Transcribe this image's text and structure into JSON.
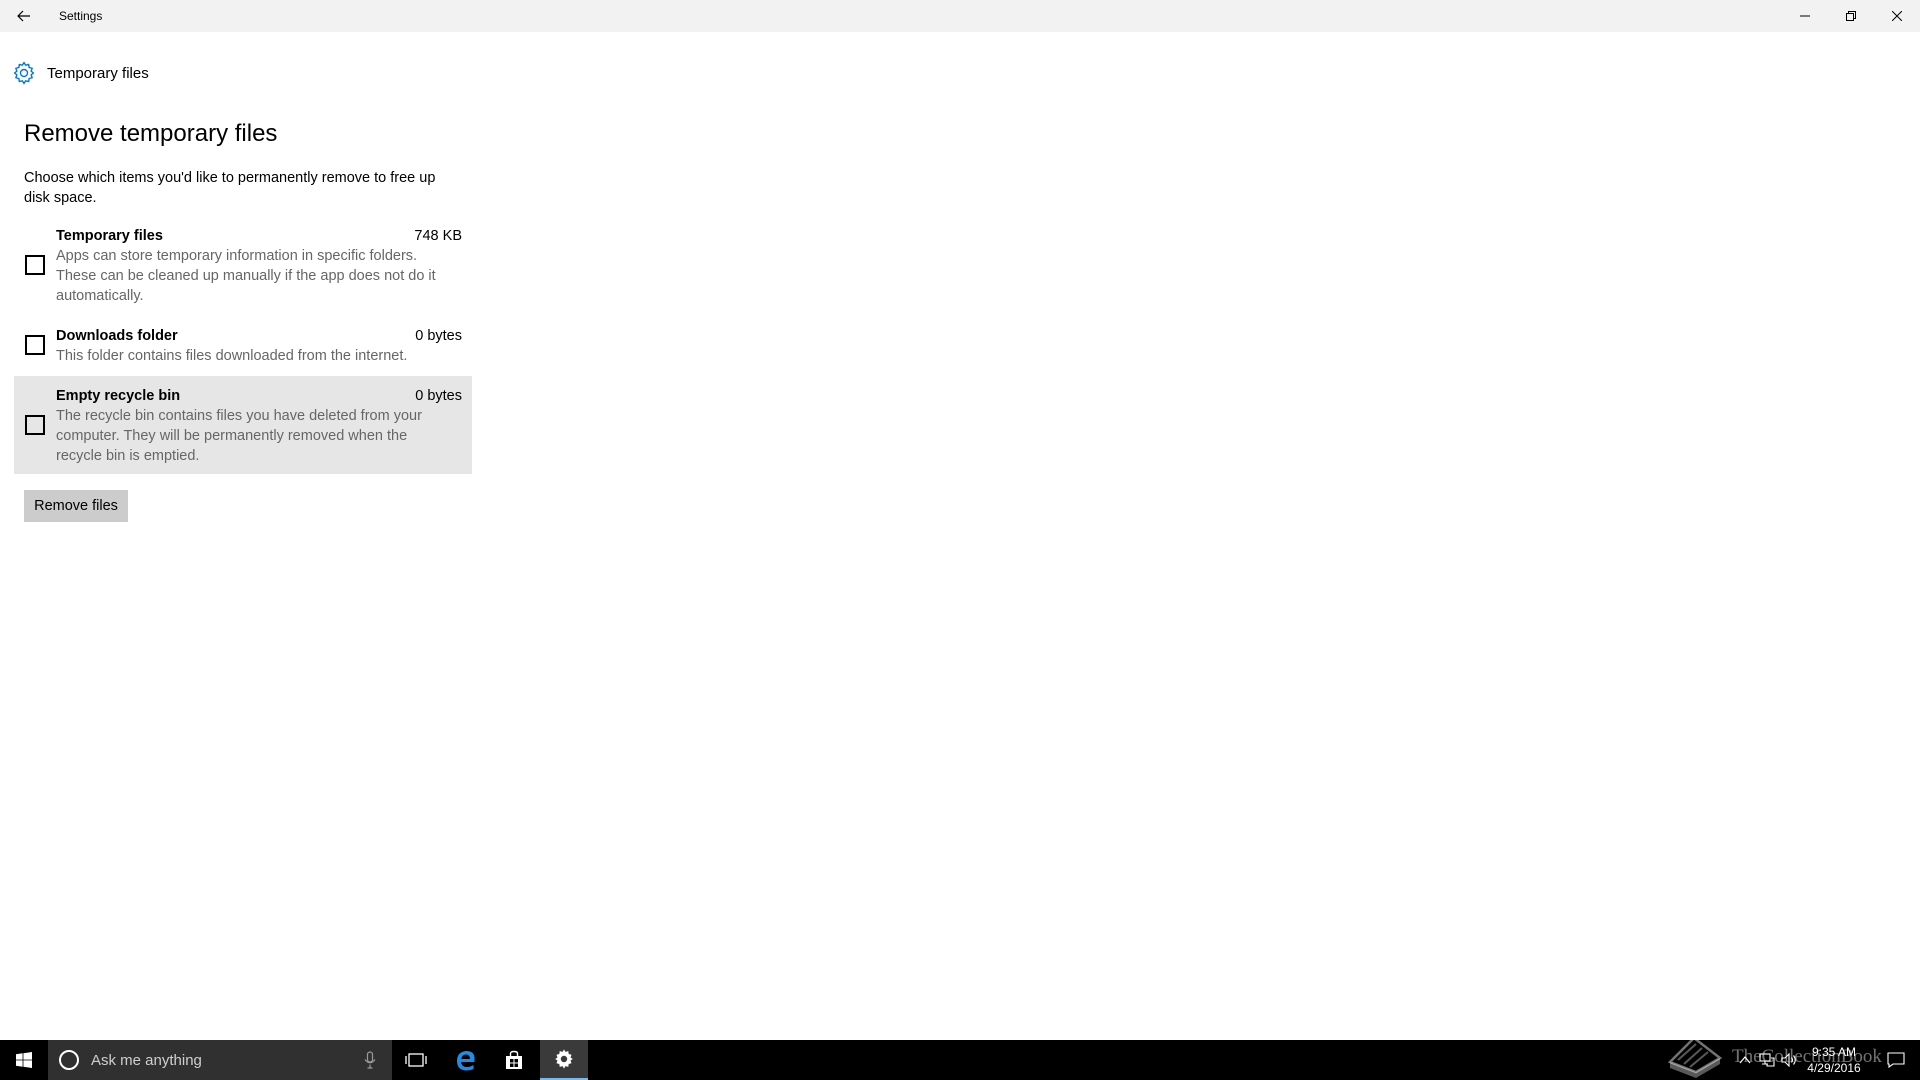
{
  "window": {
    "title": "Settings"
  },
  "header": {
    "title": "Temporary files"
  },
  "section": {
    "title": "Remove temporary files",
    "intro": "Choose which items you'd like to permanently remove to free up disk space."
  },
  "items": [
    {
      "name": "Temporary files",
      "size": "748 KB",
      "description": "Apps can store temporary information in specific folders. These can be cleaned up manually if the app does not do it automatically.",
      "checked": false
    },
    {
      "name": "Downloads folder",
      "size": "0 bytes",
      "description": "This folder contains files downloaded from the internet.",
      "checked": false
    },
    {
      "name": "Empty recycle bin",
      "size": "0 bytes",
      "description": "The recycle bin contains files you have deleted from your computer. They will be permanently removed when the recycle bin is emptied.",
      "checked": false
    }
  ],
  "actions": {
    "remove_label": "Remove files"
  },
  "taskbar": {
    "search_placeholder": "Ask me anything",
    "time": "9:35 AM",
    "date": "4/29/2016",
    "icons": [
      "windows-start-icon",
      "cortana-icon",
      "microphone-icon",
      "task-view-icon",
      "edge-icon",
      "store-icon",
      "settings-icon",
      "chevron-up-icon",
      "network-icon",
      "volume-icon",
      "action-center-icon"
    ]
  },
  "watermark": {
    "text": "TheCollectionBook"
  },
  "colors": {
    "titlebar": "#f2f2f2",
    "hover_row": "#e6e6e6",
    "button": "#cccccc",
    "taskbar": "#000000",
    "search_box": "#303030",
    "accent": "#0078d7",
    "description_text": "#666666"
  }
}
